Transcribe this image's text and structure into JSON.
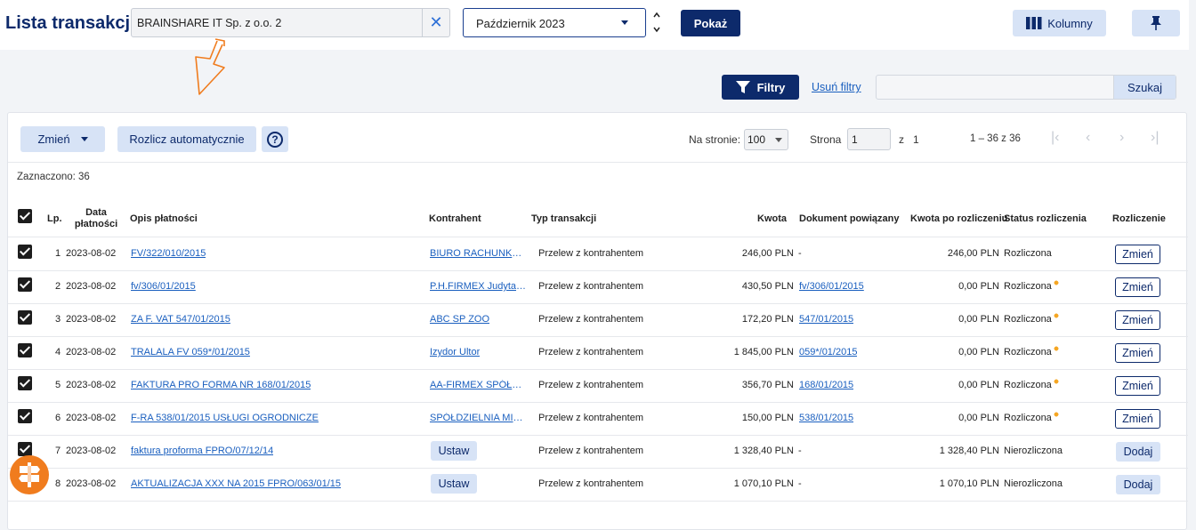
{
  "header": {
    "title": "Lista transakcji",
    "company": "BRAINSHARE IT Sp. z o.o. 2",
    "month": "Październik 2023",
    "show_label": "Pokaż",
    "columns_label": "Kolumny"
  },
  "filters": {
    "filters_label": "Filtry",
    "clear_label": "Usuń filtry",
    "search_value": "",
    "search_label": "Szukaj"
  },
  "toolbar": {
    "change_label": "Zmień",
    "auto_settle_label": "Rozlicz automatycznie",
    "help_glyph": "?",
    "per_page_label": "Na stronie:",
    "per_page_value": "100",
    "page_label": "Strona",
    "page_value": "1",
    "of_label": "z",
    "total_pages": "1",
    "range_label": "1 – 36 z 36",
    "selected_label": "Zaznaczono: 36"
  },
  "table": {
    "headers": {
      "lp": "Lp.",
      "date": "Data płatności",
      "desc": "Opis płatności",
      "contractor": "Kontrahent",
      "type": "Typ transakcji",
      "amount": "Kwota",
      "doc": "Dokument powiązany",
      "after": "Kwota po rozliczeniu",
      "status": "Status rozliczenia",
      "settle": "Rozliczenie"
    },
    "rows": [
      {
        "lp": "1",
        "date": "2023-08-02",
        "desc": "FV/322/010/2015",
        "contractor": "BIURO RACHUNKOWOŚĆ...",
        "type": "Przelew z kontrahentem",
        "amount": "246,00 PLN",
        "doc": "-",
        "after": "246,00 PLN",
        "status": "Rozliczona",
        "action": "Zmień"
      },
      {
        "lp": "2",
        "date": "2023-08-02",
        "desc": "fv/306/01/2015",
        "contractor": "P.H.FIRMEX Judyta R...",
        "type": "Przelew z kontrahentem",
        "amount": "430,50 PLN",
        "doc": "fv/306/01/2015",
        "after": "0,00 PLN",
        "status": "Rozliczona",
        "action": "Zmień"
      },
      {
        "lp": "3",
        "date": "2023-08-02",
        "desc": "ZA F. VAT 547/01/2015",
        "contractor": "ABC SP ZOO",
        "type": "Przelew z kontrahentem",
        "amount": "172,20 PLN",
        "doc": "547/01/2015",
        "after": "0,00 PLN",
        "status": "Rozliczona",
        "action": "Zmień"
      },
      {
        "lp": "4",
        "date": "2023-08-02",
        "desc": "TRALALA FV 059*/01/2015",
        "contractor": "Izydor Ultor",
        "type": "Przelew z kontrahentem",
        "amount": "1 845,00 PLN",
        "doc": "059*/01/2015",
        "after": "0,00 PLN",
        "status": "Rozliczona",
        "action": "Zmień"
      },
      {
        "lp": "5",
        "date": "2023-08-02",
        "desc": "FAKTURA PRO FORMA NR 168/01/2015",
        "contractor": "AA-FIRMEX SPÓŁKA ...",
        "type": "Przelew z kontrahentem",
        "amount": "356,70 PLN",
        "doc": "168/01/2015",
        "after": "0,00 PLN",
        "status": "Rozliczona",
        "action": "Zmień"
      },
      {
        "lp": "6",
        "date": "2023-08-02",
        "desc": "F-RA 538/01/2015 USŁUGI OGRODNICZE",
        "contractor": "SPÓŁDZIELNIA MIES...",
        "type": "Przelew z kontrahentem",
        "amount": "150,00 PLN",
        "doc": "538/01/2015",
        "after": "0,00 PLN",
        "status": "Rozliczona",
        "action": "Zmień"
      },
      {
        "lp": "7",
        "date": "2023-08-02",
        "desc": "faktura proforma FPRO/07/12/14",
        "contractor_btn": "Ustaw",
        "type": "Przelew z kontrahentem",
        "amount": "1 328,40 PLN",
        "doc": "-",
        "after": "1 328,40 PLN",
        "status": "Nierozliczona",
        "action": "Dodaj"
      },
      {
        "lp": "8",
        "date": "2023-08-02",
        "desc": "AKTUALIZACJA XXX NA 2015 FPRO/063/01/15",
        "contractor_btn": "Ustaw",
        "type": "Przelew z kontrahentem",
        "amount": "1 070,10 PLN",
        "doc": "-",
        "after": "1 070,10 PLN",
        "status": "Nierozliczona",
        "action": "Dodaj"
      }
    ]
  }
}
